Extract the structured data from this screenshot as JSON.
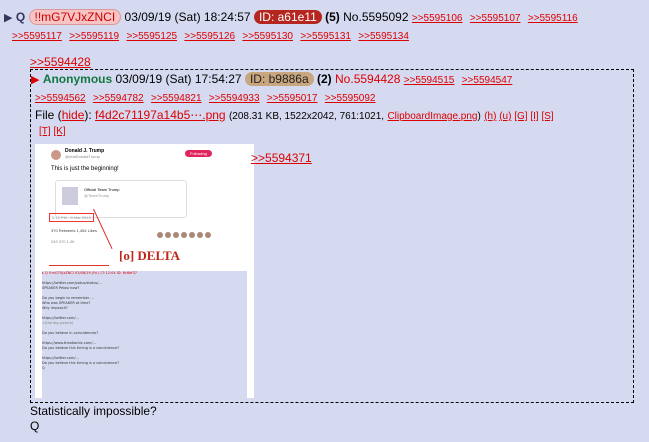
{
  "op": {
    "q_label": "Q",
    "tripcode": "!!mG7VJxZNCI",
    "datetime": "03/09/19 (Sat) 18:24:57",
    "id": "ID: a61e11",
    "post_count": "(5)",
    "post_no": "No.5595092",
    "backlinks_row1": [
      ">>5595106",
      ">>5595107",
      ">>5595116"
    ],
    "backlinks_row2": [
      ">>5595117",
      ">>5595119",
      ">>5595125",
      ">>5595126",
      ">>5595130",
      ">>5595131",
      ">>5595134"
    ]
  },
  "quote_link": ">>5594428",
  "quoted": {
    "name": "Anonymous",
    "datetime": "03/09/19 (Sat) 17:54:27",
    "id": "ID: b9886a",
    "post_count": "(2)",
    "post_no": "No.5594428",
    "backlinks_row1": [
      ">>5594515",
      ">>5594547"
    ],
    "backlinks_row2": [
      ">>5594562",
      ">>5594782",
      ">>5594821",
      ">>5594933",
      ">>5595017",
      ">>5595092"
    ],
    "file_label": "File",
    "hide_label": "hide",
    "filename": "f4d2c71197a14b5⋯.png",
    "fileinfo": "(208.31 KB, 1522x2042, 761:1021,",
    "clipboard_name": "ClipboardImage.png",
    "file_links_a": [
      "(h)",
      "(u)",
      "[G]",
      "[I]",
      "[S]"
    ],
    "file_links_b": [
      "[T]",
      "[K]"
    ],
    "side_quote": ">>5594371"
  },
  "thumbnail": {
    "tweet_name": "Donald J. Trump",
    "tweet_handle": "@realDonaldTrump",
    "follow_label": "Following",
    "tweet_text": "This is just the beginning!",
    "card_title": "Official Team Trump",
    "card_sub": "@TeamTrump",
    "timestamp": "5:12 PM - 8 Mar 2019",
    "stats": "370 Retweets   1,454 Likes",
    "actions": "249     370     1.4K",
    "delta_text": "[o] DELTA"
  },
  "message": {
    "line1": "Statistically impossible?",
    "line2": "Q"
  },
  "colors": {
    "background": "#d6daf0",
    "link": "#dd0000",
    "name_green": "#117743",
    "id_red": "#b5261e",
    "id_tan": "#c8a77e"
  }
}
